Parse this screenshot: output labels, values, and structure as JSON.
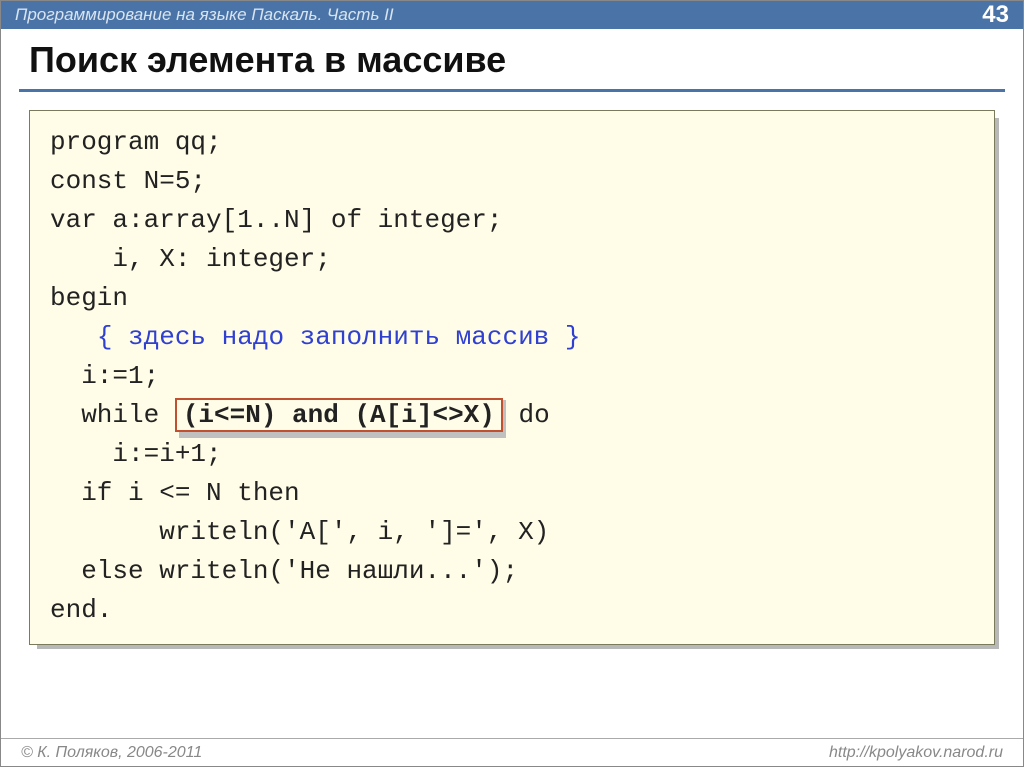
{
  "header": {
    "course_title": "Программирование на языке Паскаль. Часть II",
    "page_number": "43"
  },
  "title": "Поиск элемента в массиве",
  "code": {
    "l1": "program qq;",
    "l2": "const N=5;",
    "l3": "var a:array[1..N] of integer;",
    "l4": "    i, X: integer;",
    "l5": "begin",
    "l6_pre": "   ",
    "l6_comment": "{ здесь надо заполнить массив }",
    "l7": "  i:=1;",
    "l8_pre": "  while ",
    "l8_hl": "(i<=N) and (A[i]<>X)",
    "l8_post": " do",
    "l9": "    i:=i+1;",
    "l10": "  if i <= N then",
    "l11": "       writeln('A[', i, ']=', X)",
    "l12": "  else writeln('Не нашли...');",
    "l13": "end."
  },
  "footer": {
    "copyright": "© К. Поляков, 2006-2011",
    "url": "http://kpolyakov.narod.ru"
  }
}
